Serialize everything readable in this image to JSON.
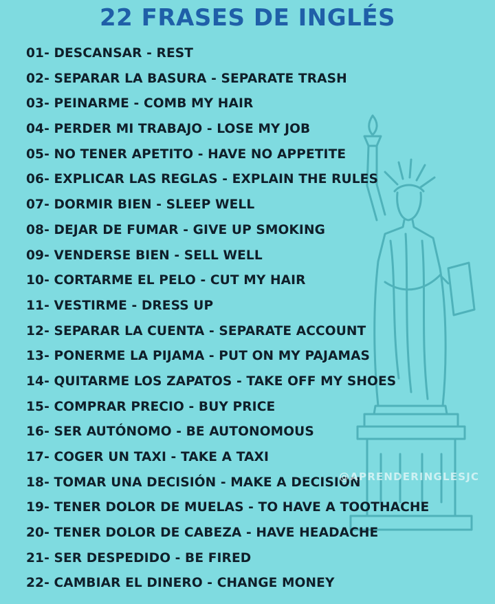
{
  "title": "22 FRASES DE INGLÉS",
  "watermark": "@APRENDERINGLESJC",
  "phrases": [
    "01- DESCANSAR - REST",
    "02- SEPARAR LA BASURA - SEPARATE TRASH",
    "03- PEINARME - COMB MY HAIR",
    "04- PERDER MI TRABAJO - LOSE MY JOB",
    "05- NO TENER APETITO - HAVE NO APPETITE",
    "06- EXPLICAR LAS REGLAS - EXPLAIN THE RULES",
    "07- DORMIR BIEN - SLEEP WELL",
    "08- DEJAR DE FUMAR - GIVE UP SMOKING",
    "09- VENDERSE BIEN - SELL WELL",
    "10- CORTARME EL PELO - CUT MY HAIR",
    "11- VESTIRME - DRESS UP",
    "12- SEPARAR LA CUENTA - SEPARATE ACCOUNT",
    "13- PONERME LA PIJAMA - PUT ON MY PAJAMAS",
    "14- QUITARME LOS ZAPATOS - TAKE OFF MY SHOES",
    "15- COMPRAR PRECIO - BUY PRICE",
    "16- SER AUTÓNOMO - BE AUTONOMOUS",
    "17- COGER UN TAXI - TAKE A TAXI",
    "18- TOMAR UNA DECISIÓN - MAKE A DECISION",
    "19- TENER DOLOR DE MUELAS - TO HAVE A TOOTHACHE",
    "20- TENER DOLOR DE CABEZA - HAVE HEADACHE",
    "21- SER DESPEDIDO - BE FIRED",
    "22- CAMBIAR EL DINERO - CHANGE MONEY"
  ],
  "colors": {
    "background": "#7fdbe0",
    "title": "#1f5fa8",
    "text": "#0f1f2a",
    "illustration_line": "#4aaeb6"
  },
  "icons": {
    "illustration": "statue-of-liberty-icon"
  }
}
